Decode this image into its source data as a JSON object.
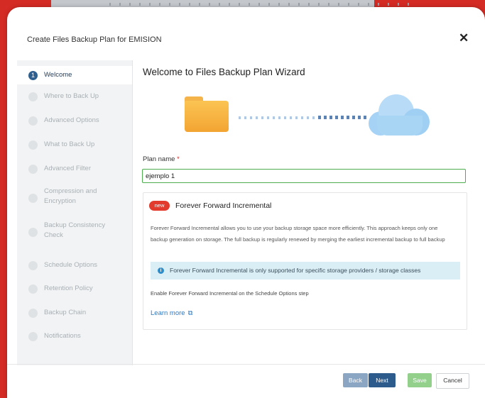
{
  "dialog": {
    "title": "Create Files Backup Plan for EMISION",
    "close_icon": "✕"
  },
  "sidebar": {
    "steps": [
      {
        "num": "1",
        "label": "Welcome"
      },
      {
        "label": "Where to Back Up"
      },
      {
        "label": "Advanced Options"
      },
      {
        "label": "What to Back Up"
      },
      {
        "label": "Advanced Filter"
      },
      {
        "label_line1": "Compression and",
        "label_line2": "Encryption"
      },
      {
        "label_line1": "Backup Consistency",
        "label_line2": "Check"
      },
      {
        "label": "Schedule Options"
      },
      {
        "label": "Retention Policy"
      },
      {
        "label": "Backup Chain"
      },
      {
        "label": "Notifications"
      }
    ]
  },
  "main": {
    "wizard_title": "Welcome to Files Backup Plan Wizard",
    "plan_name_label": "Plan name",
    "required_mark": "*",
    "plan_name_value": "ejemplo 1",
    "card": {
      "badge": "new",
      "title": "Forever Forward Incremental",
      "description": "Forever Forward Incremental allows you to use your backup storage space more efficiently. This approach keeps only one backup generation on storage. The full backup is regularly renewed by merging the earliest incremental backup to full backup",
      "info_icon": "i",
      "info_text": "Forever Forward Incremental is only supported for specific storage providers / storage classes",
      "enable_text": "Enable Forever Forward Incremental on the Schedule Options step",
      "learn_more": "Learn more",
      "external_icon": "⧉"
    }
  },
  "footer": {
    "back": "Back",
    "next": "Next",
    "save": "Save",
    "cancel": "Cancel"
  },
  "colors": {
    "accent": "#2d5c8c",
    "background_brand": "#d42b24",
    "success": "#4cae4c",
    "badge": "#e23b2e"
  }
}
